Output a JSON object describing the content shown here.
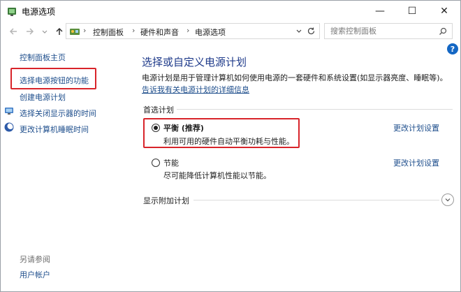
{
  "window": {
    "title": "电源选项",
    "minimize_glyph": "—",
    "maximize_glyph": "☐",
    "close_glyph": "✕"
  },
  "nav": {
    "back_icon": "arrow-left-icon",
    "forward_icon": "arrow-right-icon",
    "recent_icon": "chevron-down-icon",
    "up_icon": "arrow-up-icon"
  },
  "address": {
    "crumbs": [
      "控制面板",
      "硬件和声音",
      "电源选项"
    ],
    "separator": "›"
  },
  "search": {
    "placeholder": "搜索控制面板"
  },
  "sidebar": {
    "home": "控制面板主页",
    "items": [
      {
        "label": "选择电源按钮的功能"
      },
      {
        "label": "创建电源计划"
      },
      {
        "label": "选择关闭显示器的时间"
      },
      {
        "label": "更改计算机睡眠时间"
      }
    ],
    "see_also": "另请参阅",
    "user_accounts": "用户帐户"
  },
  "main": {
    "heading": "选择或自定义电源计划",
    "description": "电源计划是用于管理计算机如何使用电源的一套硬件和系统设置(如显示器亮度、睡眠等)。",
    "description_link": "告诉我有关电源计划的详细信息",
    "preferred_label": "首选计划",
    "plans": [
      {
        "name": "平衡 (推荐)",
        "desc": "利用可用的硬件自动平衡功耗与性能。",
        "link": "更改计划设置",
        "selected": true
      },
      {
        "name": "节能",
        "desc": "尽可能降低计算机性能以节能。",
        "link": "更改计划设置",
        "selected": false
      }
    ],
    "more_plans": "显示附加计划"
  },
  "colors": {
    "link": "#1e4e8c",
    "heading": "#1e3a8a",
    "highlight_box": "#d8242a",
    "help": "#1467c4"
  }
}
